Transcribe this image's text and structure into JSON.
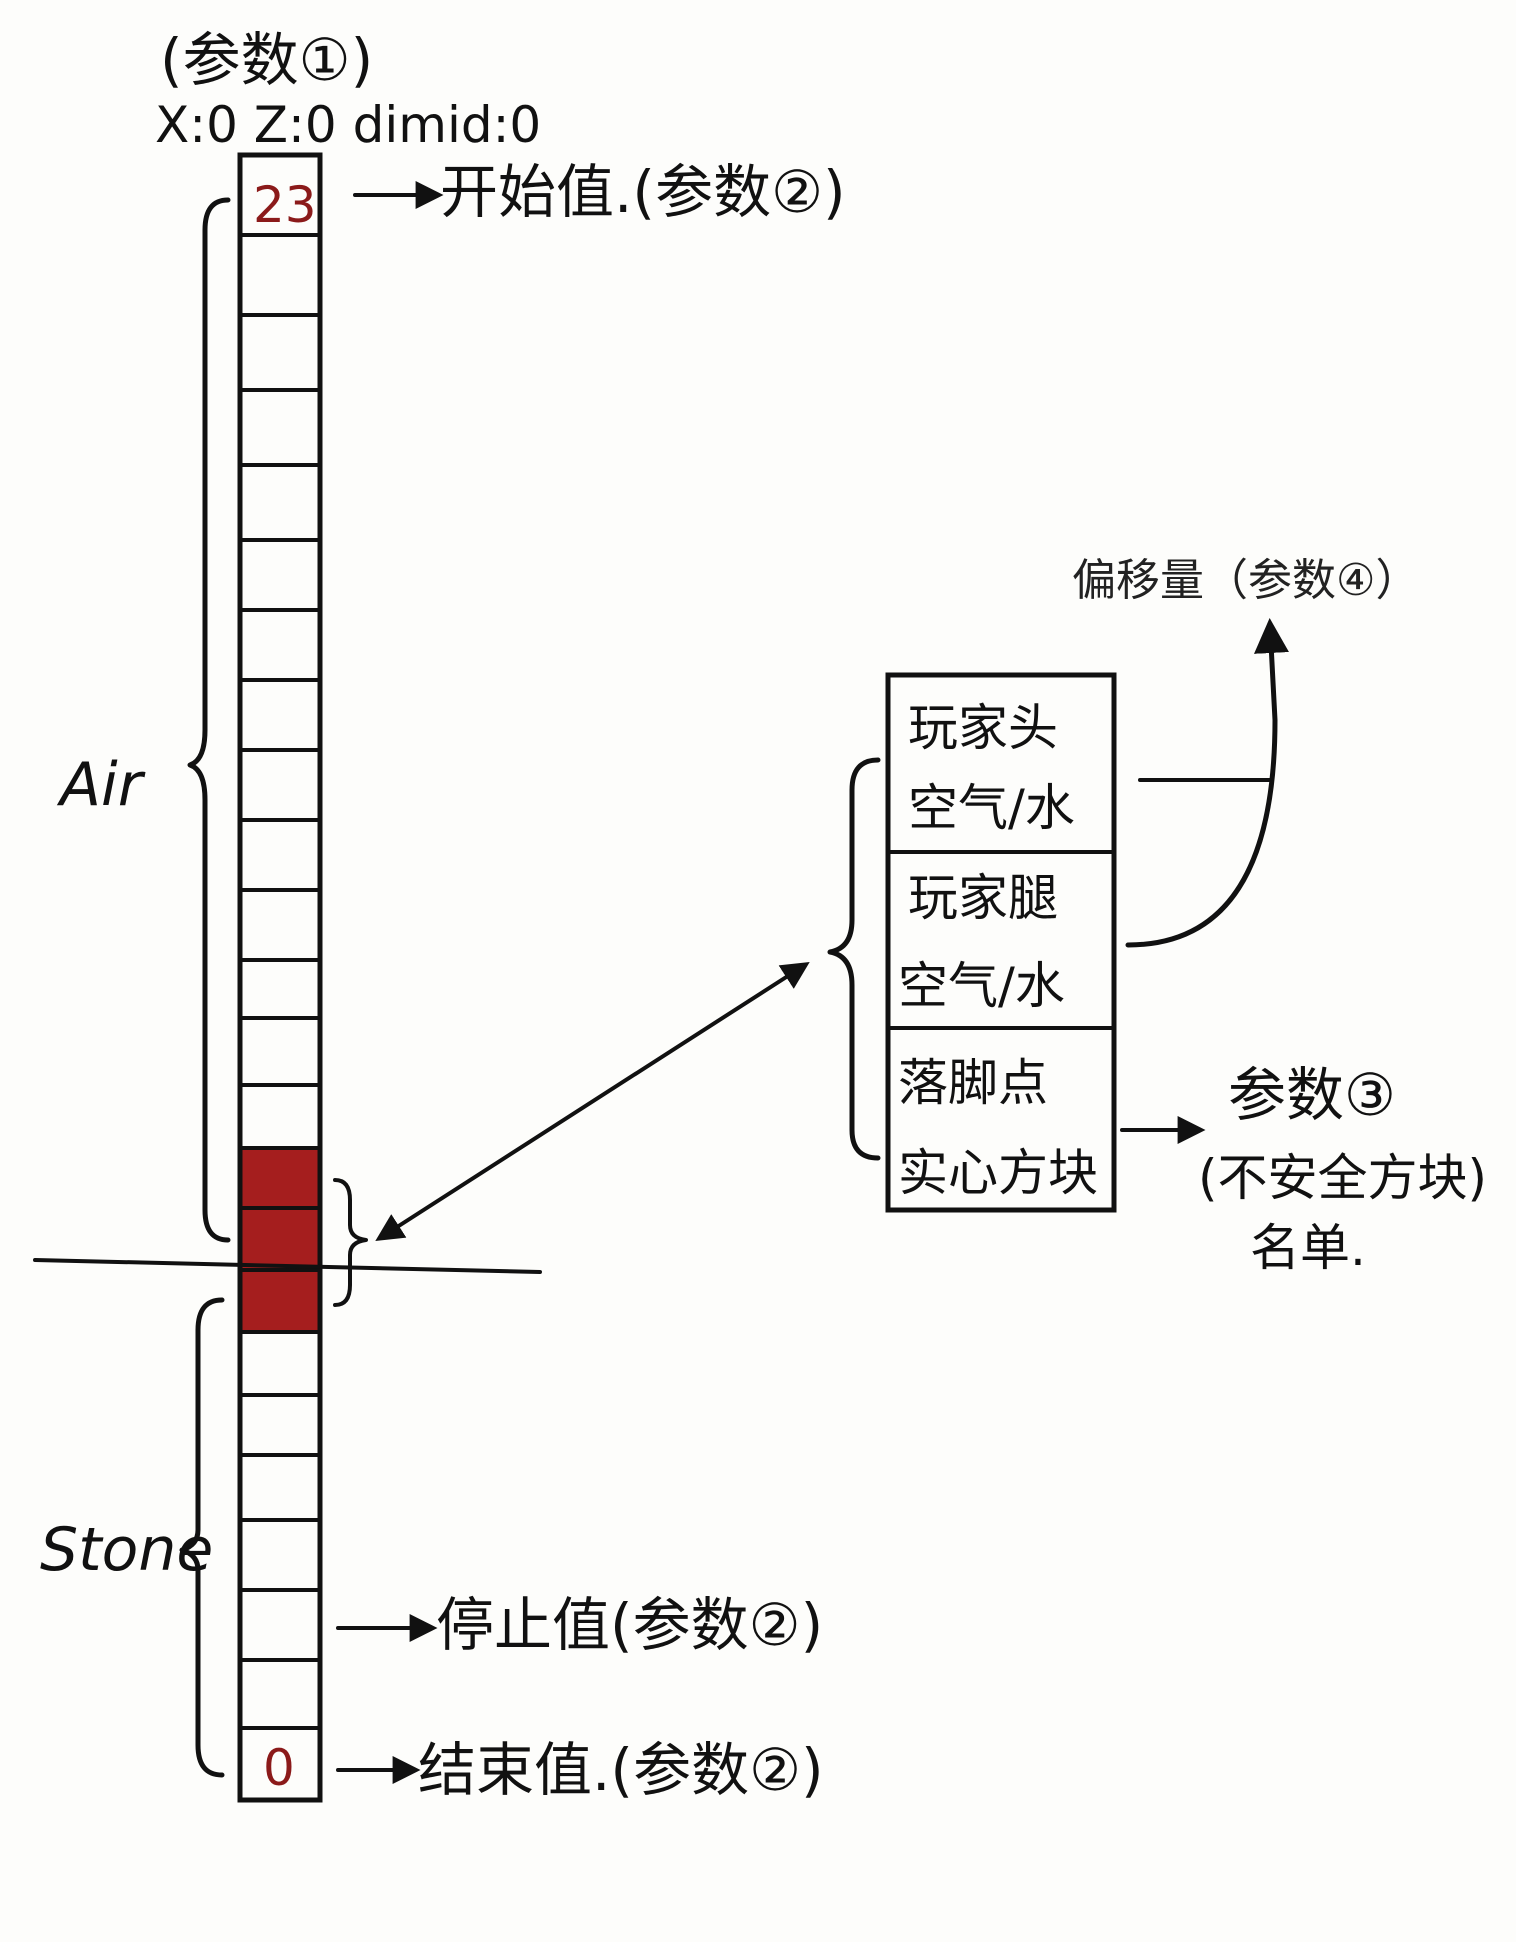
{
  "header": {
    "param1_label": "(参数①)",
    "coords": "X:0   Z:0   dimid:0"
  },
  "column": {
    "top_value": "23",
    "bottom_value": "0",
    "filled_color": "#a51e1e"
  },
  "regions": {
    "air_label": "Air",
    "stone_label": "Stone"
  },
  "annotations": {
    "start_value": "开始值.(参数②)",
    "stop_value": "停止值(参数②)",
    "end_value": "结束值.(参数②)",
    "offset": "偏移量（参数④）",
    "param3": "参数③",
    "unsafe_blocks": "(不安全方块)",
    "list": "名单."
  },
  "check_box": {
    "head_line1": "玩家头",
    "head_line2": "空气/水",
    "legs_line1": "玩家腿",
    "legs_line2": "空气/水",
    "foot_line1": "落脚点",
    "foot_line2": "实心方块"
  }
}
